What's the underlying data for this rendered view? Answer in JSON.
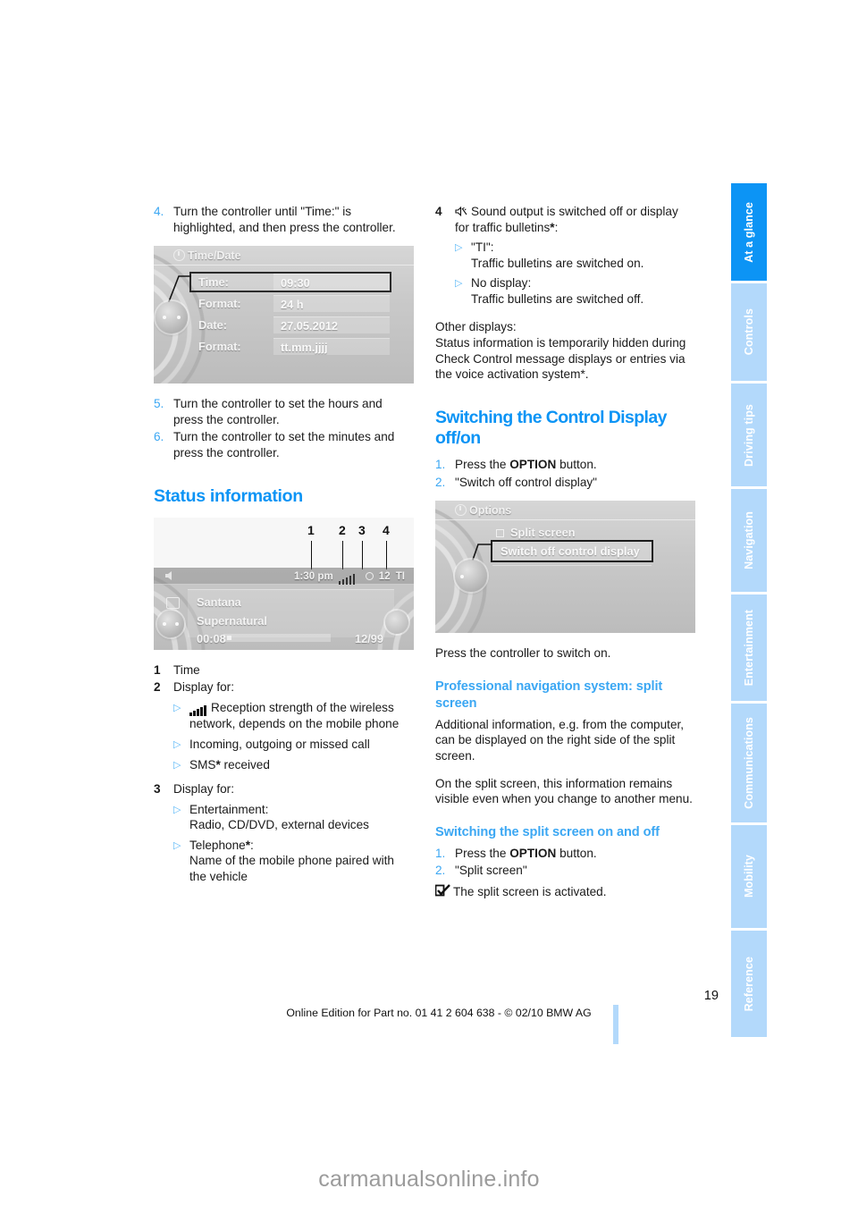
{
  "page": {
    "number": "19",
    "footer_line": "Online Edition for Part no. 01 41 2 604 638 - © 02/10 BMW AG",
    "watermark": "carmanualsonline.info",
    "accent_blue": "#0c94f5",
    "tab_inactive_blue": "#b3d9fb"
  },
  "sidebar": {
    "tabs": [
      {
        "label": "At a glance",
        "active": true
      },
      {
        "label": "Controls",
        "active": false
      },
      {
        "label": "Driving tips",
        "active": false
      },
      {
        "label": "Navigation",
        "active": false
      },
      {
        "label": "Entertainment",
        "active": false
      },
      {
        "label": "Communications",
        "active": false
      },
      {
        "label": "Mobility",
        "active": false
      },
      {
        "label": "Reference",
        "active": false
      }
    ]
  },
  "left_column": {
    "step4": {
      "num": "4.",
      "text": "Turn the controller until \"Time:\" is highlighted, and then press the controller."
    },
    "figure_time": {
      "title": "Time/Date",
      "rows": [
        {
          "label": "Time:",
          "value": "09:30",
          "selected": true
        },
        {
          "label": "Format:",
          "value": "24 h",
          "selected": false
        },
        {
          "label": "Date:",
          "value": "27.05.2012",
          "selected": false
        },
        {
          "label": "Format:",
          "value": "tt.mm.jjjj",
          "selected": false
        }
      ]
    },
    "step5": {
      "num": "5.",
      "text": "Turn the controller to set the hours and press the controller."
    },
    "step6": {
      "num": "6.",
      "text": "Turn the controller to set the minutes and press the controller."
    },
    "heading_status": "Status information",
    "figure_status": {
      "callout_numbers": [
        "1",
        "2",
        "3",
        "4"
      ],
      "status_bar": {
        "time": "1:30 pm",
        "signal": "signal-bars",
        "disc": "12",
        "ti": "TI"
      },
      "artist": "Santana",
      "album": "Supernatural",
      "elapsed": "00:08",
      "track": "12/99"
    },
    "legend": [
      {
        "num": "1",
        "text": "Time",
        "bullets": []
      },
      {
        "num": "2",
        "text": "Display for:",
        "bullets": [
          {
            "icon": "signal-bars",
            "text": "Reception strength of the wireless network, depends on the mobile phone"
          },
          {
            "icon": "",
            "text": "Incoming, outgoing or missed call"
          },
          {
            "icon": "",
            "text": "SMS* received"
          }
        ]
      },
      {
        "num": "3",
        "text": "Display for:",
        "bullets": [
          {
            "icon": "",
            "text": "Entertainment:\nRadio, CD/DVD, external devices"
          },
          {
            "icon": "",
            "text": "Telephone*:\nName of the mobile phone paired with the vehicle"
          }
        ]
      }
    ]
  },
  "right_column": {
    "legend4": {
      "num": "4",
      "icon": "mute-speaker-icon",
      "text": "Sound output is switched off or display for traffic bulletins*:",
      "bullets": [
        {
          "text": "\"TI\":\nTraffic bulletins are switched on."
        },
        {
          "text": "No display:\nTraffic bulletins are switched off."
        }
      ]
    },
    "other_displays": {
      "label": "Other displays:",
      "text": "Status information is temporarily hidden during Check Control message displays or entries via the voice activation system*."
    },
    "heading_switch_display": "Switching the Control Display off/on",
    "steps": [
      {
        "num": "1.",
        "text_before": "Press the ",
        "bold": "OPTION",
        "text_after": " button."
      },
      {
        "num": "2.",
        "text_before": "\"Switch off control display\"",
        "bold": "",
        "text_after": ""
      }
    ],
    "figure_options": {
      "title": "Options",
      "item_checkbox": "Split screen",
      "item_selected": "Switch off control display"
    },
    "press_controller": "Press the controller to switch on.",
    "heading_prof_nav": "Professional navigation system: split screen",
    "prof_nav_p1": "Additional information, e.g. from the computer, can be displayed on the right side of the split screen.",
    "prof_nav_p2": "On the split screen, this information remains visible even when you change to another menu.",
    "subheading_split": "Switching the split screen on and off",
    "split_steps": [
      {
        "num": "1.",
        "text_before": "Press the ",
        "bold": "OPTION",
        "text_after": " button."
      },
      {
        "num": "2.",
        "text_before": "\"Split screen\"",
        "bold": "",
        "text_after": ""
      }
    ],
    "split_result": "The split screen is activated."
  }
}
